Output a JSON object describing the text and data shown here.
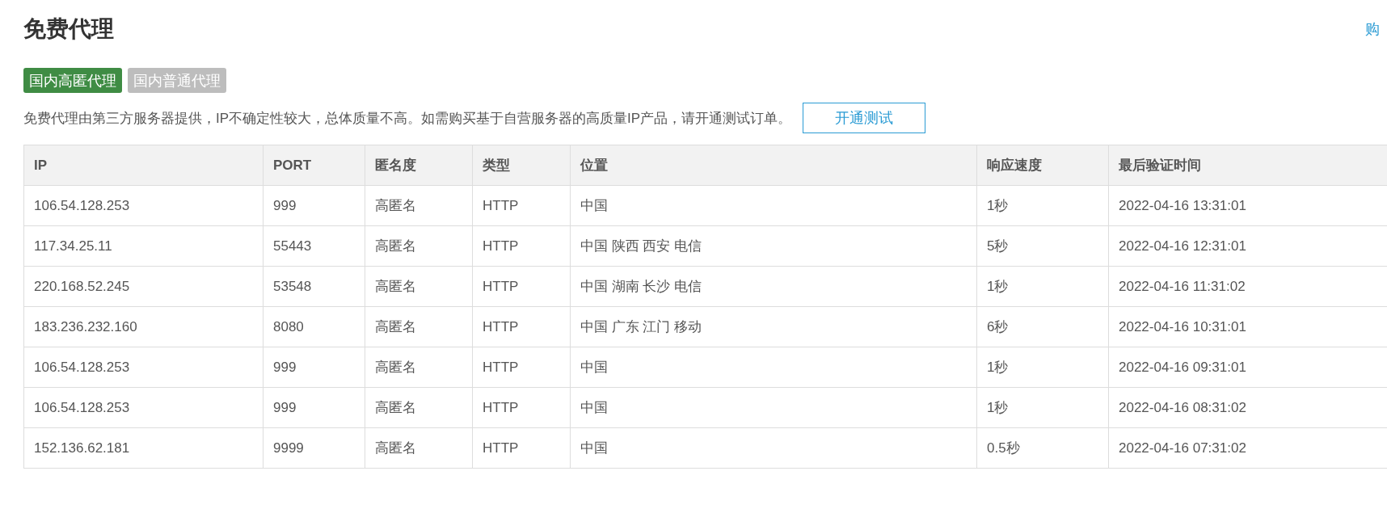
{
  "title": "免费代理",
  "top_link": "购",
  "tabs": [
    {
      "label": "国内高匿代理",
      "selected": true
    },
    {
      "label": "国内普通代理",
      "selected": false
    }
  ],
  "notice": "免费代理由第三方服务器提供，IP不确定性较大，总体质量不高。如需购买基于自营服务器的高质量IP产品，请开通测试订单。",
  "test_button": "开通测试",
  "table": {
    "columns": [
      "IP",
      "PORT",
      "匿名度",
      "类型",
      "位置",
      "响应速度",
      "最后验证时间"
    ],
    "rows": [
      [
        "106.54.128.253",
        "999",
        "高匿名",
        "HTTP",
        "中国",
        "1秒",
        "2022-04-16 13:31:01"
      ],
      [
        "117.34.25.11",
        "55443",
        "高匿名",
        "HTTP",
        "中国 陕西 西安 电信",
        "5秒",
        "2022-04-16 12:31:01"
      ],
      [
        "220.168.52.245",
        "53548",
        "高匿名",
        "HTTP",
        "中国 湖南 长沙 电信",
        "1秒",
        "2022-04-16 11:31:02"
      ],
      [
        "183.236.232.160",
        "8080",
        "高匿名",
        "HTTP",
        "中国 广东 江门 移动",
        "6秒",
        "2022-04-16 10:31:01"
      ],
      [
        "106.54.128.253",
        "999",
        "高匿名",
        "HTTP",
        "中国",
        "1秒",
        "2022-04-16 09:31:01"
      ],
      [
        "106.54.128.253",
        "999",
        "高匿名",
        "HTTP",
        "中国",
        "1秒",
        "2022-04-16 08:31:02"
      ],
      [
        "152.136.62.181",
        "9999",
        "高匿名",
        "HTTP",
        "中国",
        "0.5秒",
        "2022-04-16 07:31:02"
      ]
    ]
  }
}
